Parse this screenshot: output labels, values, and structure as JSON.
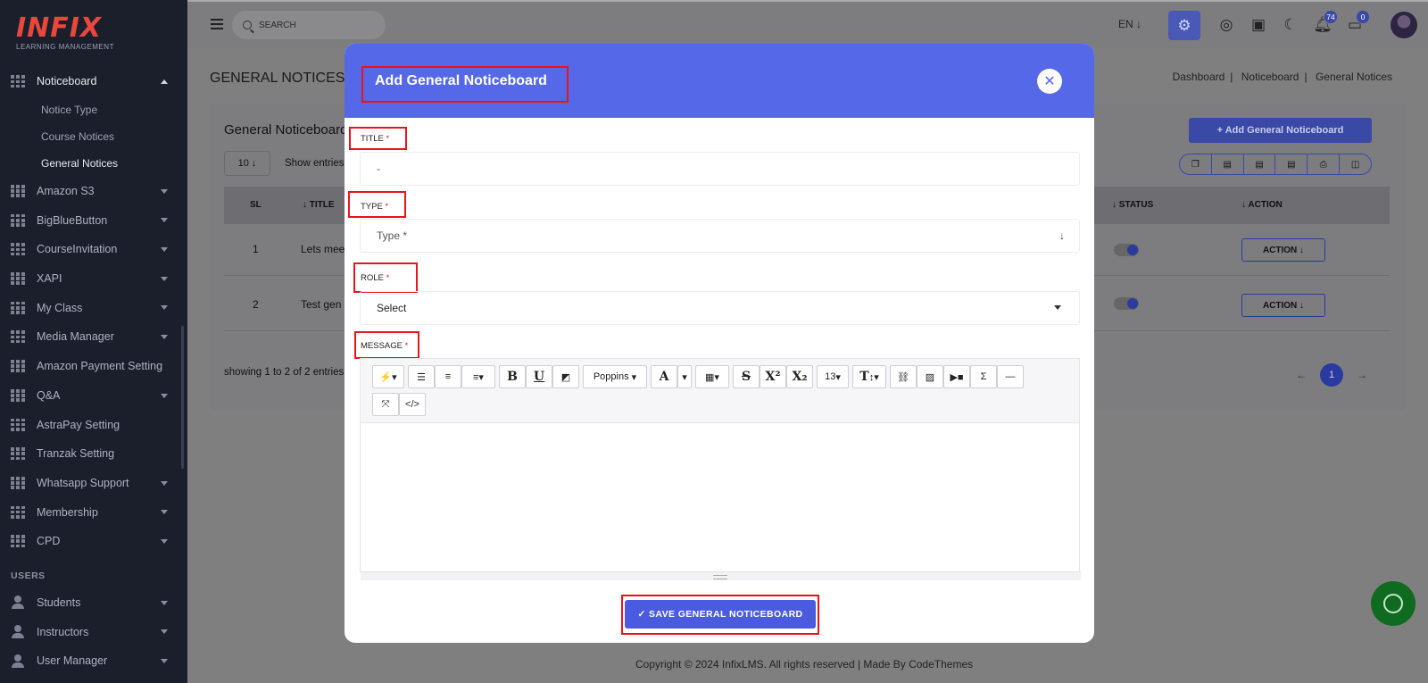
{
  "logo": {
    "brand": "INFIX",
    "tagline": "LEARNING MANAGEMENT"
  },
  "sidebar": {
    "items": [
      {
        "label": "Noticeboard",
        "open": true,
        "children": [
          "Notice Type",
          "Course Notices",
          "General Notices"
        ]
      },
      {
        "label": "Amazon S3"
      },
      {
        "label": "BigBlueButton"
      },
      {
        "label": "CourseInvitation"
      },
      {
        "label": "XAPI"
      },
      {
        "label": "My Class"
      },
      {
        "label": "Media Manager"
      },
      {
        "label": "Amazon Payment Setting"
      },
      {
        "label": "Q&A"
      },
      {
        "label": "AstraPay Setting"
      },
      {
        "label": "Tranzak Setting"
      },
      {
        "label": "Whatsapp Support"
      },
      {
        "label": "Membership"
      },
      {
        "label": "CPD"
      }
    ],
    "active_child": "General Notices",
    "users_section": "USERS",
    "user_items": [
      "Students",
      "Instructors",
      "User Manager"
    ]
  },
  "topbar": {
    "search_placeholder": "SEARCH",
    "language": "EN ↓",
    "notifications_count": "74",
    "messages_count": "0"
  },
  "page": {
    "title": "GENERAL NOTICES",
    "breadcrumb": [
      "Dashboard",
      "Noticeboard",
      "General Notices"
    ]
  },
  "card": {
    "title": "General Noticeboard",
    "add_button": "+ Add General Noticeboard",
    "per_page": "10 ↓",
    "show_entries": "Show entries",
    "columns": {
      "sl": "SL",
      "title": "↓ TITLE",
      "status": "↓ STATUS",
      "action": "↓ ACTION"
    },
    "rows": [
      {
        "sl": "1",
        "title": "Lets mee",
        "action": "ACTION ↓"
      },
      {
        "sl": "2",
        "title": "Test gen",
        "action": "ACTION ↓"
      }
    ],
    "showing": "showing 1 to 2 of 2 entries",
    "current_page": "1"
  },
  "modal": {
    "title": "Add General Noticeboard",
    "title_label": "TITLE",
    "title_placeholder": "-",
    "type_label": "TYPE",
    "type_placeholder": "Type *",
    "role_label": "ROLE",
    "role_value": "Select",
    "message_label": "MESSAGE",
    "required_mark": "*",
    "editor_font": "Poppins",
    "editor_font_size": "13",
    "save_button": "✓ SAVE GENERAL NOTICEBOARD"
  },
  "footer": {
    "text": "Copyright © 2024 InfixLMS. All rights reserved | Made By CodeThemes"
  },
  "colors": {
    "accent": "#5568e8",
    "highlight": "#e8141c",
    "sidebar_bg": "#1b1e2b"
  }
}
